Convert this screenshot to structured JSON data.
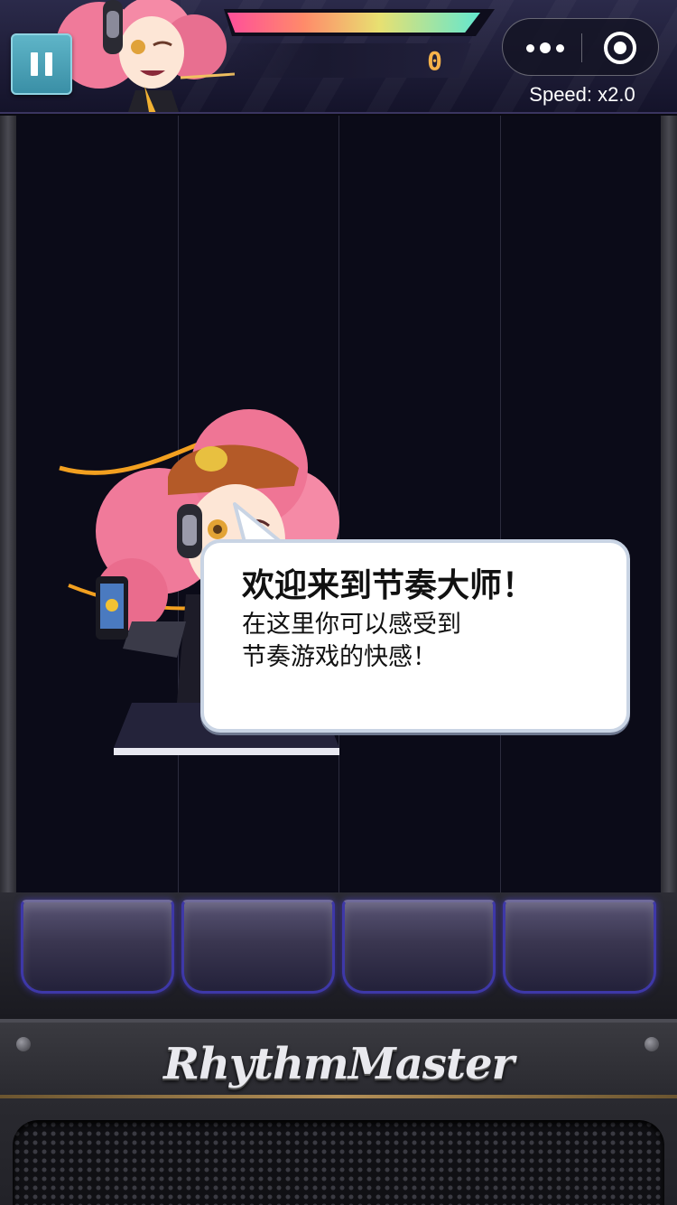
{
  "hud": {
    "score": "0",
    "hp_fraction": 0.96,
    "speed_label": "Speed: x2.0",
    "pause_icon": "pause-icon",
    "menu_icon": "more-dots-icon",
    "close_icon": "target-circle-icon"
  },
  "play_field": {
    "lane_count": 4
  },
  "dialog": {
    "title": "欢迎来到节奏大师！",
    "lines": [
      "在这里你可以感受到",
      "节奏游戏的快感！"
    ]
  },
  "footer": {
    "brand": "RhythmMaster"
  },
  "colors": {
    "score": "#f6b24a",
    "pad_glow": "#3e38a8",
    "pause_button": "#4aa3b8"
  }
}
